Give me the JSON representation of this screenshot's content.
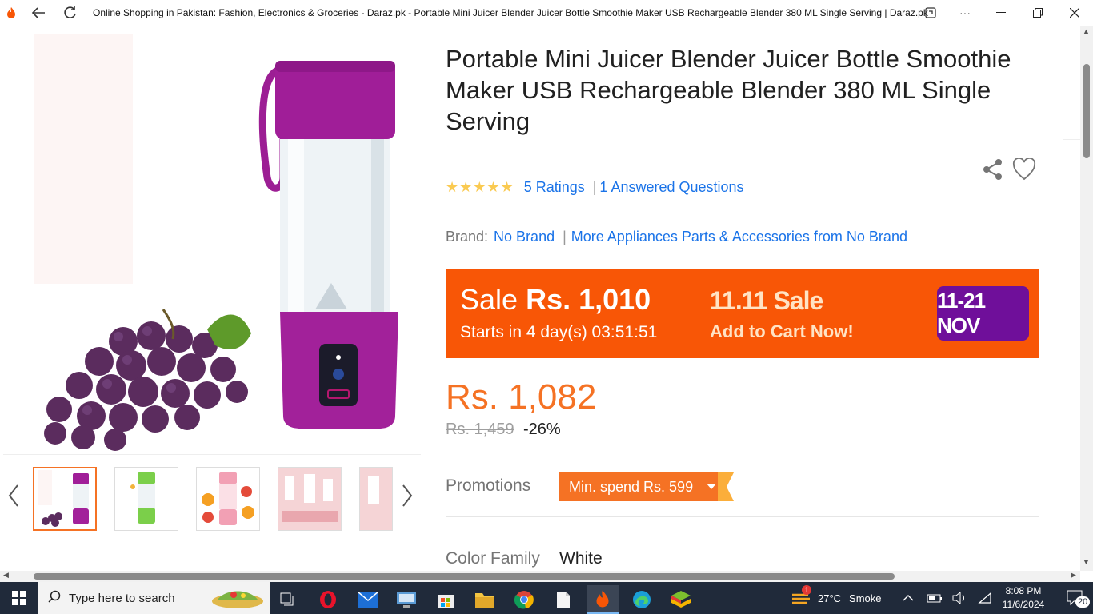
{
  "browser": {
    "tab_title": "Online Shopping in Pakistan: Fashion, Electronics & Groceries - Daraz.pk - Portable Mini Juicer Blender Juicer Bottle Smoothie Maker USB Rechargeable Blender 380 ML Single Serving | Daraz.pk"
  },
  "product": {
    "title": "Portable Mini Juicer Blender Juicer Bottle Smoothie Maker USB Rechargeable Blender 380 ML Single Serving",
    "rating_stars": 5,
    "stars_glyph": "★★★★★",
    "ratings_link": "5 Ratings",
    "questions_link": "1 Answered Questions",
    "brand_label": "Brand:",
    "brand_value": "No Brand",
    "more_from_link": "More Appliances Parts & Accessories from No Brand",
    "price": "Rs. 1,082",
    "old_price": "Rs. 1,459",
    "discount": "-26%",
    "promotions_label": "Promotions",
    "promotion_badge": "Min. spend Rs. 599",
    "color_label": "Color Family",
    "color_value": "White"
  },
  "sale_banner": {
    "sale_word": "Sale",
    "sale_price": "Rs. 1,010",
    "starts_in": "Starts in 4 day(s) 03:51:51",
    "event_title": "11.11 Sale",
    "cta": "Add to Cart Now!",
    "dates": "11-21 NOV"
  },
  "gallery": {
    "thumbnails": [
      "purple-blender",
      "green-blender",
      "pink-blender",
      "pink-promo",
      "pink-promo-2"
    ],
    "active_index": 0
  },
  "taskbar": {
    "search_placeholder": "Type here to search",
    "weather_temp": "27°C",
    "weather_desc": "Smoke",
    "weather_badge": "1",
    "time": "8:08 PM",
    "date": "11/6/2024",
    "notifications_count": "20"
  },
  "colors": {
    "daraz_orange": "#f57224",
    "sale_orange": "#f85606",
    "link_blue": "#1a73e8",
    "star_yellow": "#faca51",
    "sale_date_purple": "#6f0f9a"
  }
}
